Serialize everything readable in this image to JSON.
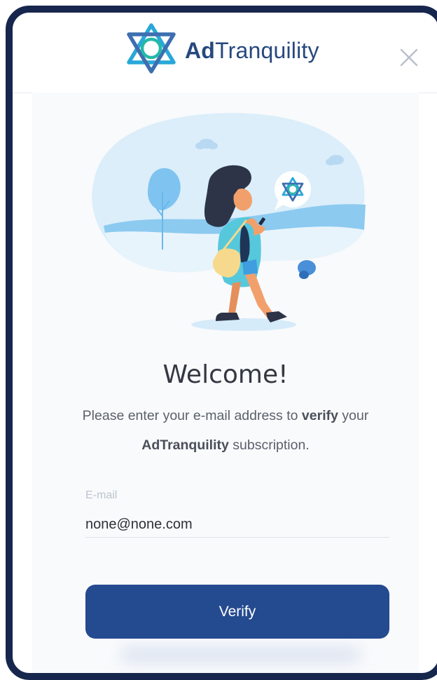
{
  "app": {
    "logo_bold": "Ad",
    "logo_light": "Tranquility"
  },
  "icons": {
    "logo": "adtranquility-star-logo-icon",
    "close": "close-icon"
  },
  "welcome": {
    "title": "Welcome!",
    "text_before": "Please enter your e-mail address to ",
    "text_bold1": "verify",
    "text_mid": " your ",
    "text_bold2": "AdTranquility",
    "text_after": " subscription."
  },
  "email": {
    "label": "E-mail",
    "value": "none@none.com"
  },
  "buttons": {
    "verify": "Verify"
  },
  "colors": {
    "brand_blue": "#27487f",
    "button": "#244a8f",
    "frame": "#17264d",
    "accent_cyan": "#27b3d6"
  }
}
